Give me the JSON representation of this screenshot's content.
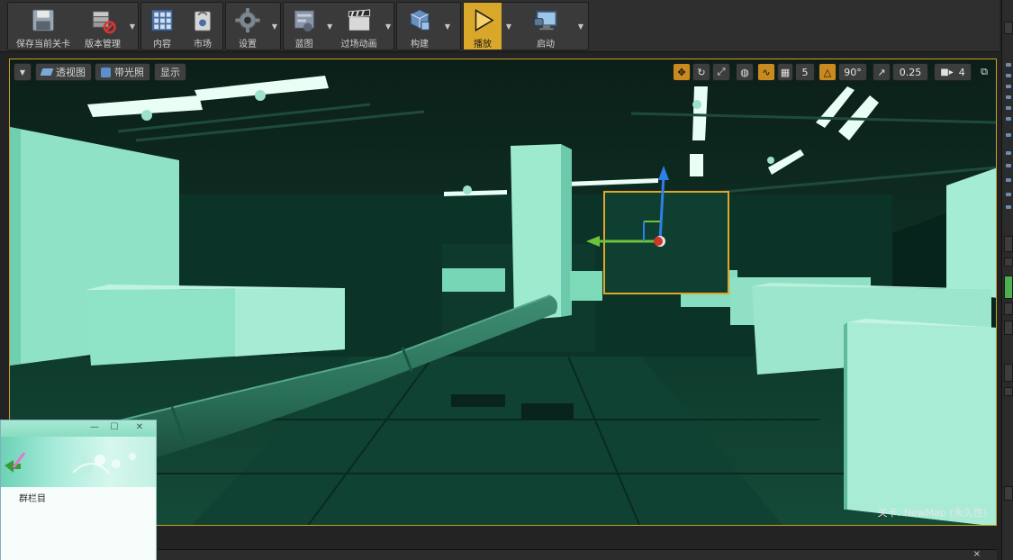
{
  "toolbar": {
    "save_current": "保存当前关卡",
    "source_control": "版本管理",
    "content": "内容",
    "marketplace": "市场",
    "settings": "设置",
    "blueprints": "蓝图",
    "cinematics": "过场动画",
    "build": "构建",
    "play": "播放",
    "launch": "启动"
  },
  "viewport": {
    "perspective": "透视图",
    "lit": "带光照",
    "show": "显示",
    "grid_snap": "5",
    "rotation_snap": "90°",
    "scale_snap": "0.25",
    "camera_speed": "4",
    "level_label": "关卡:  NewMap (永久性)"
  },
  "float_window": {
    "label": "群栏目",
    "minimize": "—",
    "maximize": "☐",
    "close": "✕"
  },
  "bottom_bar": {
    "tab": "",
    "close": "×"
  },
  "colors": {
    "accent": "#d9a72a",
    "scene_tint": "#2a9c7c"
  }
}
